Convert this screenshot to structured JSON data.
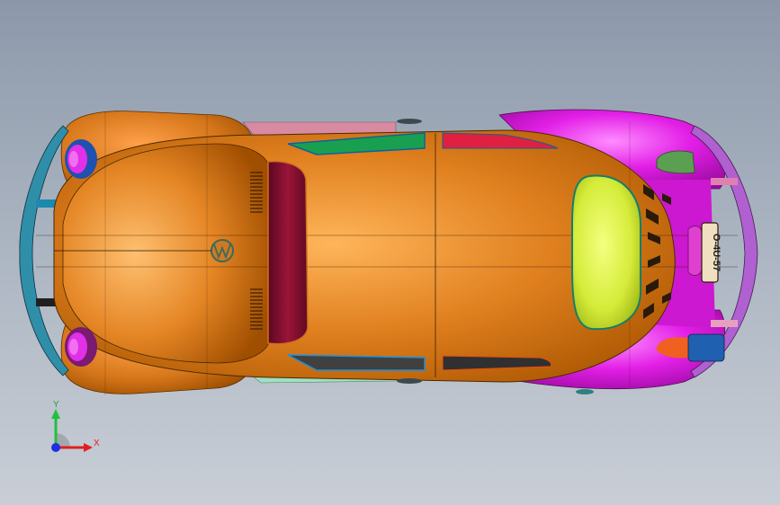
{
  "scene": {
    "model": "beetle-car-top-view",
    "colors": {
      "body": "#d9781c",
      "body_highlight": "#f6b05a",
      "rear_fender": "#e21fe6",
      "windshield": "#8a1030",
      "rear_window": "#d8f04a",
      "side_glass_green": "#18a050",
      "side_glass_red": "#e02040",
      "bumper_teal": "#2f8fa8",
      "bumper_purple": "#b060d0",
      "pink_parts": "#d88aa0"
    }
  },
  "license_plate": {
    "text": "O-4U-57"
  },
  "triad": {
    "x_label": "X",
    "y_label": "Y",
    "x_color": "#e02020",
    "y_color": "#20c040",
    "z_color": "#2030e0"
  }
}
